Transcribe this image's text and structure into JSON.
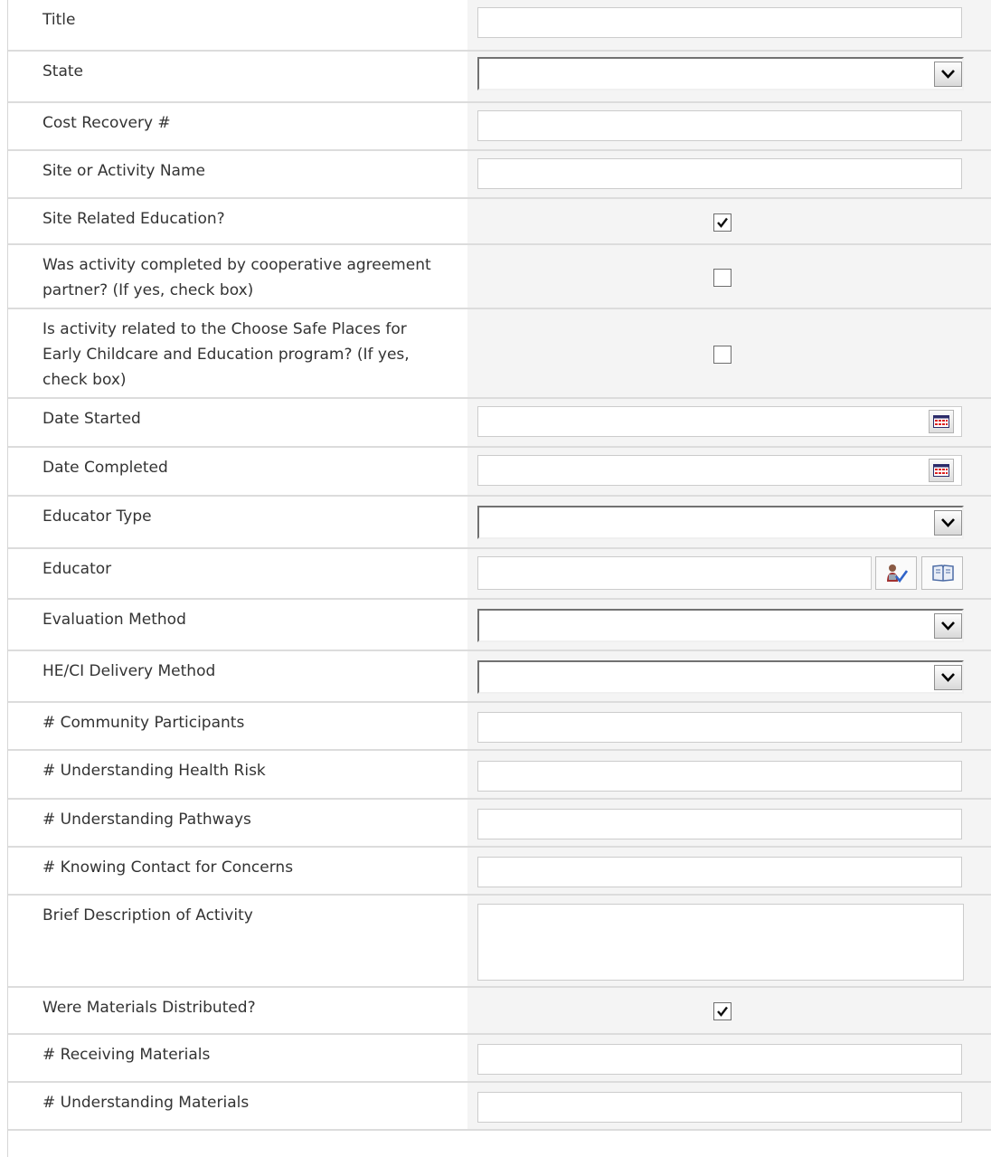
{
  "form": {
    "title_label": "Title",
    "state_label": "State",
    "state_value": "",
    "cost_recovery_label": "Cost Recovery #",
    "site_name_label": "Site or Activity Name",
    "site_related_label": "Site Related Education?",
    "site_related_checked": true,
    "coop_partner_label": "Was activity completed by cooperative agreement partner? (If yes, check box)",
    "coop_partner_checked": false,
    "choose_safe_label": "Is activity related to the Choose Safe Places for Early Childcare and Education program? (If yes, check box)",
    "choose_safe_checked": false,
    "date_started_label": "Date Started",
    "date_completed_label": "Date Completed",
    "educator_type_label": "Educator Type",
    "educator_label": "Educator",
    "evaluation_method_label": "Evaluation Method",
    "delivery_method_label": "HE/CI Delivery Method",
    "community_participants_label": "# Community Participants",
    "health_risk_label": "# Understanding Health Risk",
    "pathways_label": "# Understanding Pathways",
    "contact_label": "# Knowing Contact for Concerns",
    "description_label": "Brief Description of Activity",
    "materials_distributed_label": "Were Materials Distributed?",
    "materials_distributed_checked": true,
    "receiving_materials_label": "# Receiving Materials",
    "understanding_materials_label": "# Understanding Materials"
  },
  "icons": {
    "calendar": "calendar-icon",
    "select_arrow": "chevron-down-icon",
    "check": "checkmark-icon",
    "user_check": "user-check-icon",
    "address_book": "address-book-icon"
  },
  "colors": {
    "cell_background": "#f4f4f4",
    "row_divider": "#dcdcdc",
    "label_text": "#333333"
  }
}
